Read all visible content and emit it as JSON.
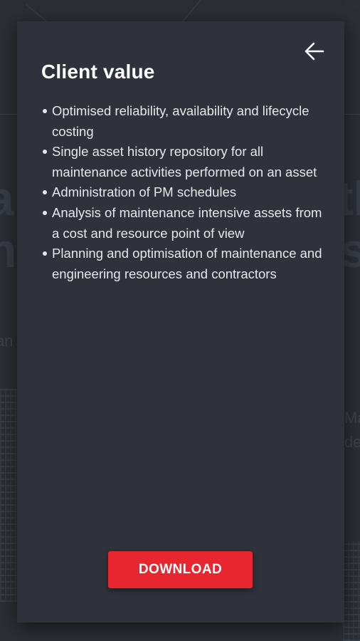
{
  "background": {
    "fragment_1": "a",
    "fragment_2": "n",
    "fragment_3": "tl",
    "fragment_4": "s",
    "fragment_5": "an",
    "fragment_6": "Ma",
    "fragment_7": "de"
  },
  "modal": {
    "title": "Client value",
    "back_icon": "arrow-left-icon",
    "bullets": [
      "Optimised reliability, availability and lifecycle costing",
      "Single asset history repository for all maintenance activities performed on an asset",
      "Administration of PM schedules",
      "Analysis of maintenance intensive assets from a cost and resource point of view",
      "Planning and optimisation of maintenance and engineering resources and contractors"
    ],
    "download_label": "DOWNLOAD"
  },
  "colors": {
    "modal_background": "#2f323b",
    "accent": "#e8262f",
    "text": "#e6e7eb"
  }
}
